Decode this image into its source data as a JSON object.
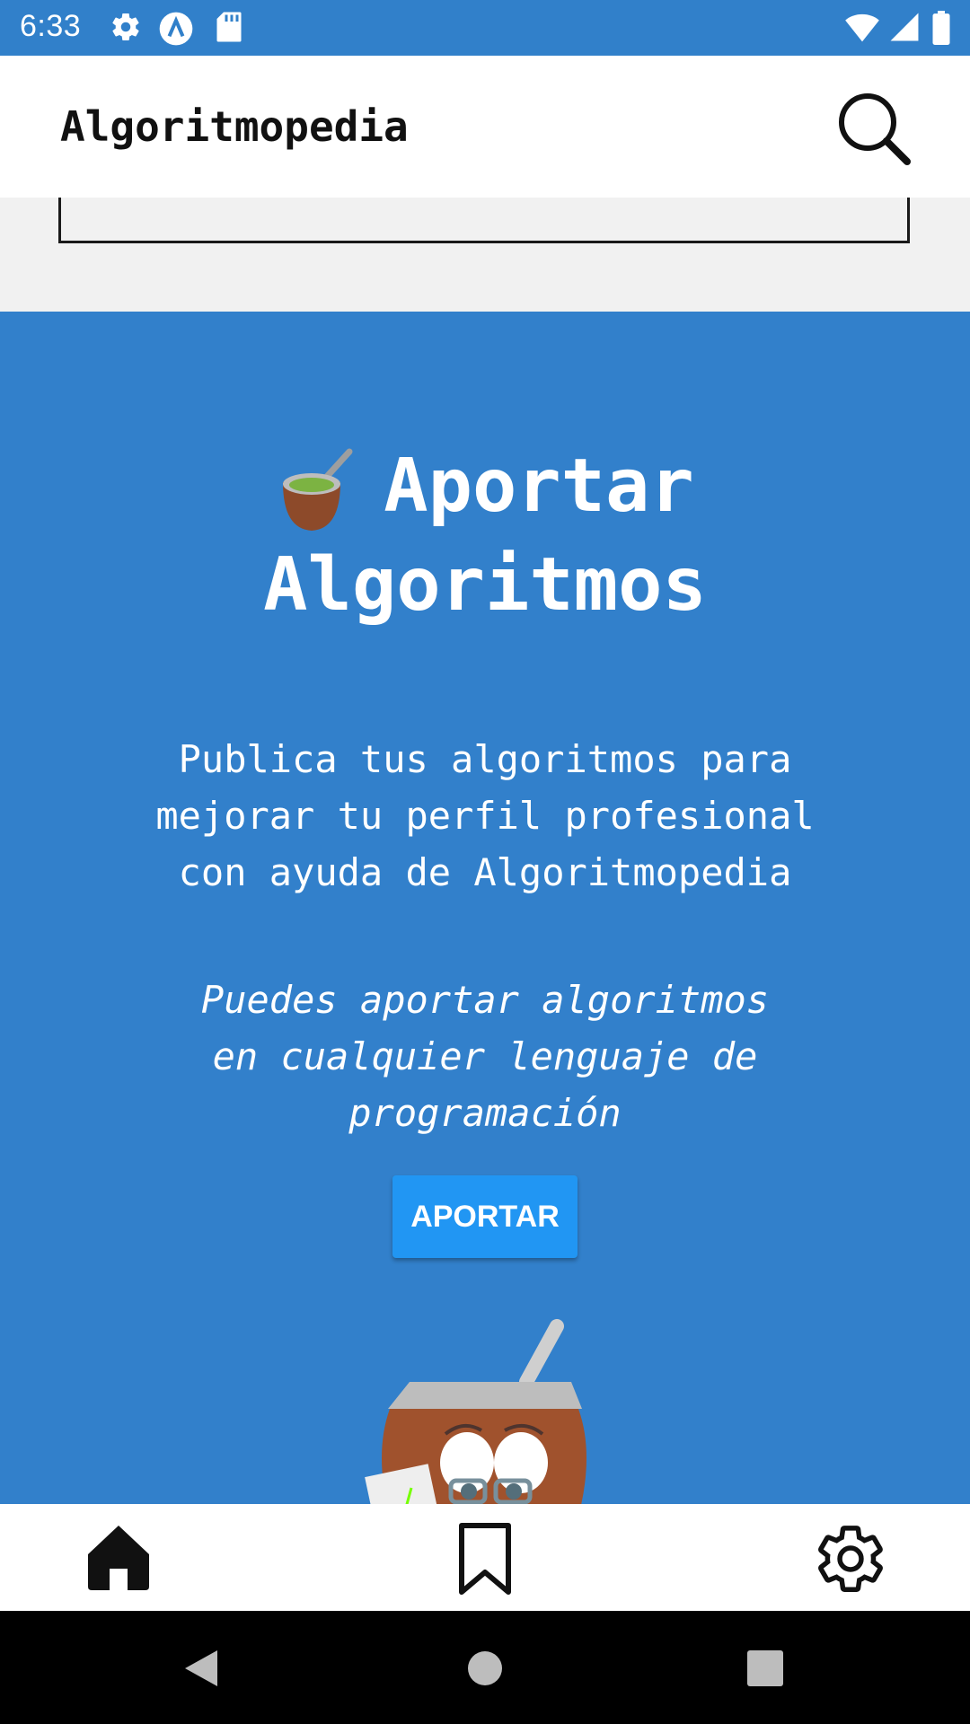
{
  "status_bar": {
    "time": "6:33",
    "icons": [
      "settings-icon",
      "a-badge-icon",
      "sd-card-icon",
      "wifi-icon",
      "signal-icon",
      "battery-icon"
    ]
  },
  "app_bar": {
    "title": "Algoritmopedia",
    "search_icon": "search-icon"
  },
  "hero": {
    "title_line1": "Aportar",
    "title_line2": "Algoritmos",
    "description_lines": [
      "Publica tus algoritmos para",
      "mejorar tu perfil profesional",
      "con ayuda de Algoritmopedia"
    ],
    "note_lines": [
      "Puedes aportar algoritmos",
      "en cualquier lenguaje de",
      "programación"
    ],
    "button_label": "APORTAR",
    "colors": {
      "background": "#3280cb",
      "button": "#2196f3"
    }
  },
  "bottom_nav": {
    "items": [
      "home-icon",
      "bookmark-icon",
      "settings-icon"
    ]
  },
  "system_nav": {
    "items": [
      "back-icon",
      "home-circle-icon",
      "recents-icon"
    ]
  }
}
